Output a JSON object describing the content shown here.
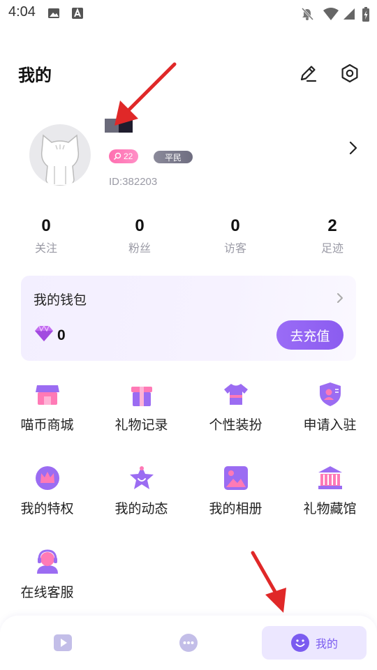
{
  "status_bar": {
    "time": "4:04"
  },
  "header": {
    "title": "我的"
  },
  "profile": {
    "level": "22",
    "rank": "平民",
    "id_text": "ID:382203"
  },
  "stats": [
    {
      "value": "0",
      "label": "关注"
    },
    {
      "value": "0",
      "label": "粉丝"
    },
    {
      "value": "0",
      "label": "访客"
    },
    {
      "value": "2",
      "label": "足迹"
    }
  ],
  "wallet": {
    "title": "我的钱包",
    "balance": "0",
    "recharge_label": "去充值"
  },
  "menu": [
    {
      "label": "喵币商城",
      "icon": "store-icon"
    },
    {
      "label": "礼物记录",
      "icon": "gift-icon"
    },
    {
      "label": "个性装扮",
      "icon": "shirt-icon"
    },
    {
      "label": "申请入驻",
      "icon": "badge-icon"
    },
    {
      "label": "我的特权",
      "icon": "crown-icon"
    },
    {
      "label": "我的动态",
      "icon": "star-icon"
    },
    {
      "label": "我的相册",
      "icon": "album-icon"
    },
    {
      "label": "礼物藏馆",
      "icon": "museum-icon"
    },
    {
      "label": "在线客服",
      "icon": "headset-icon"
    }
  ],
  "tabbar": {
    "active_label": "我的"
  },
  "colors": {
    "accent": "#8b5cf0",
    "pink": "#ff7ab6"
  }
}
